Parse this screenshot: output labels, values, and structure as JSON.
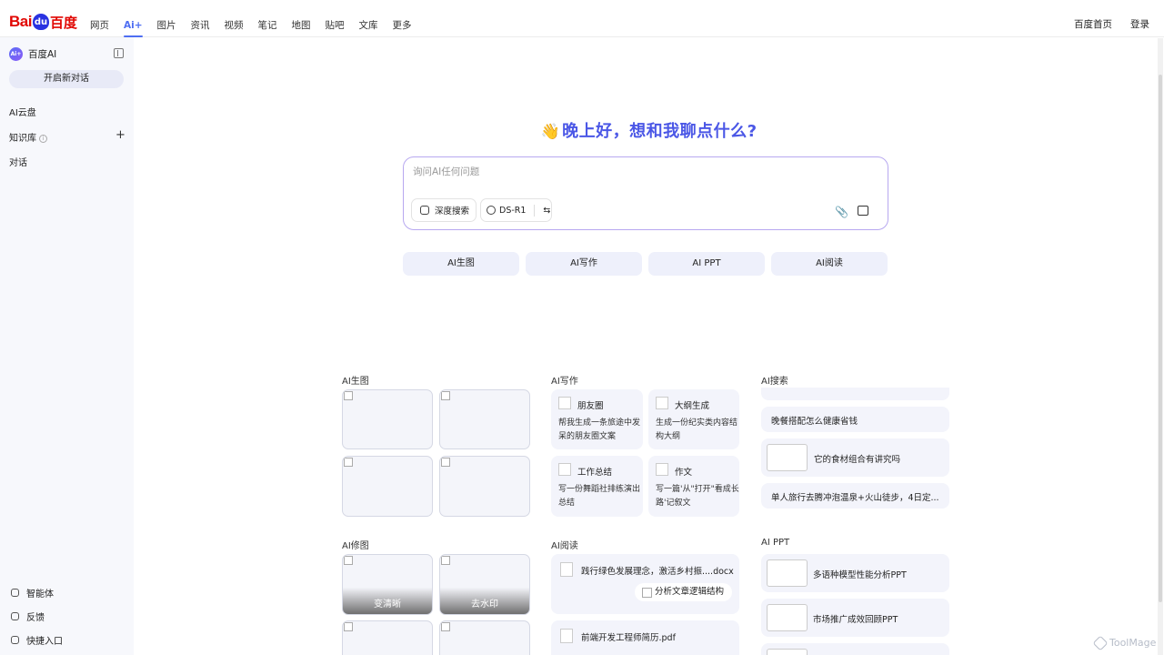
{
  "brand": {
    "logo_bai": "Bai",
    "logo_du": "du",
    "logo_cn": "百度"
  },
  "nav": [
    "网页",
    "Ai+",
    "图片",
    "资讯",
    "视频",
    "笔记",
    "地图",
    "贴吧",
    "文库",
    "更多"
  ],
  "top_right": {
    "home": "百度首页",
    "login": "登录"
  },
  "sidebar": {
    "badge": "Ai+",
    "title": "百度AI",
    "new_chat": "开启新对话",
    "cloud": "AI云盘",
    "knowledge": "知识库",
    "knowledge_info": "i",
    "knowledge_add": "+",
    "dialog": "对话",
    "agent": "智能体",
    "feedback": "反馈",
    "shortcut": "快捷入口"
  },
  "greeting": {
    "wave": "👋",
    "text": "晚上好，想和我聊点什么?"
  },
  "composer": {
    "placeholder": "询问AI任何问题",
    "deep_search": "深度搜索",
    "model": "DS-R1",
    "swap": "⇆",
    "attach": "📎"
  },
  "quick": [
    "AI生图",
    "AI写作",
    "AI PPT",
    "AI阅读"
  ],
  "sections": {
    "gen": "AI生图",
    "write": "AI写作",
    "search": "AI搜索",
    "retouch": "AI修图",
    "read": "AI阅读",
    "ppt": "AI PPT"
  },
  "retouch_caps": [
    "变清晰",
    "去水印"
  ],
  "write_cards": [
    {
      "title": "朋友圈",
      "desc": "帮我生成一条旅途中发呆的朋友圈文案"
    },
    {
      "title": "大纲生成",
      "desc": "生成一份纪实类内容结构大纲"
    },
    {
      "title": "工作总结",
      "desc": "写一份舞蹈社排练演出总结"
    },
    {
      "title": "作文",
      "desc": "写一篇'从\"打开\"看成长路'记叙文"
    }
  ],
  "search_items": [
    "晚餐搭配怎么健康省钱",
    "它的食材组合有讲究吗",
    "单人旅行去腾冲泡温泉+火山徒步，4日定..."
  ],
  "read_items": [
    {
      "title": "践行绿色发展理念，激活乡村振....docx",
      "pill": "分析文章逻辑结构"
    },
    {
      "title": "前端开发工程师简历.pdf"
    }
  ],
  "ppt_items": [
    "多语种模型性能分析PPT",
    "市场推广成效回顾PPT"
  ],
  "watermark": "ToolMage"
}
